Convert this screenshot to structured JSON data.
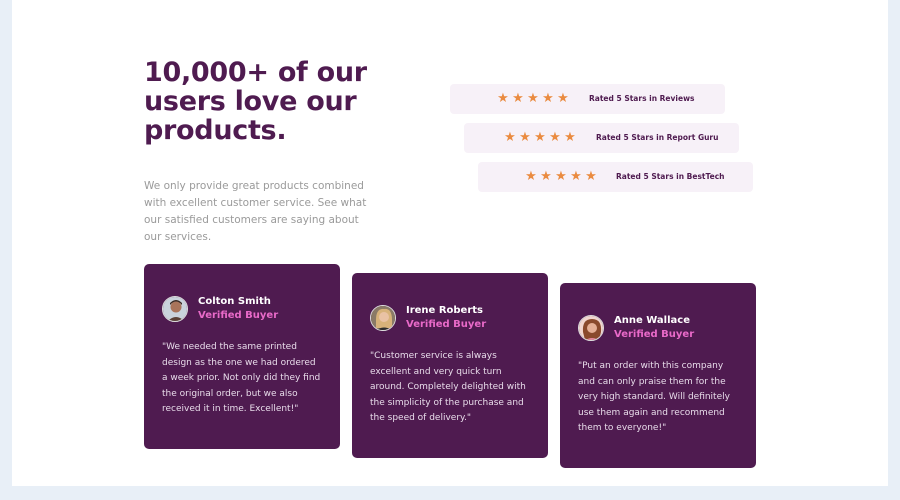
{
  "headline": "10,000+ of our users love our products.",
  "intro": "We only provide great products combined with excellent customer service. See what our satisfied customers are saying about our services.",
  "ratings": [
    {
      "stars": 5,
      "label": "Rated 5 Stars in Reviews"
    },
    {
      "stars": 5,
      "label": "Rated 5 Stars in Report Guru"
    },
    {
      "stars": 5,
      "label": "Rated 5 Stars in BestTech"
    }
  ],
  "star_glyph": "★",
  "colors": {
    "brand": "#4f1b50",
    "accent_pink": "#e96ac9",
    "star": "#ea8b40",
    "rating_bg": "#f7f1f8",
    "page_bg": "#e8eff7"
  },
  "testimonials": [
    {
      "name": "Colton Smith",
      "badge": "Verified Buyer",
      "quote": "\"We needed the same printed design as the one we had ordered a week prior. Not only did they find the original order, but we also received it in time. Excellent!\"",
      "avatar": "avatar-colton"
    },
    {
      "name": "Irene Roberts",
      "badge": "Verified Buyer",
      "quote": "\"Customer service is always excellent and very quick turn around. Completely delighted with the simplicity of the purchase and the speed of delivery.\"",
      "avatar": "avatar-irene"
    },
    {
      "name": "Anne Wallace",
      "badge": "Verified Buyer",
      "quote": "\"Put an order with this company and can only praise them for the very high standard. Will definitely use them again and recommend them to everyone!\"",
      "avatar": "avatar-anne"
    }
  ]
}
